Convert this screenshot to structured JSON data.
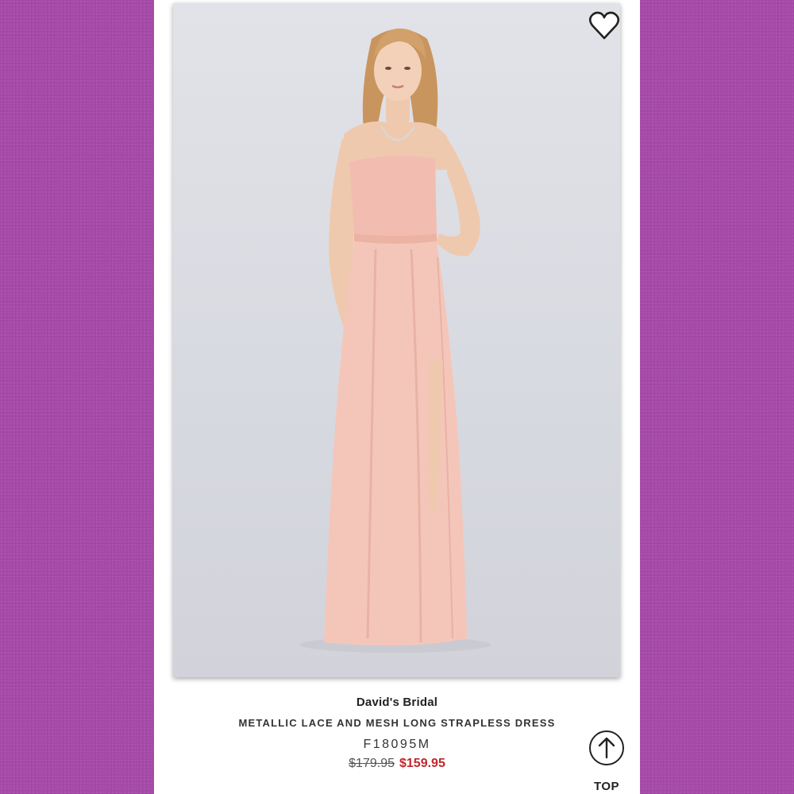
{
  "product": {
    "brand": "David's Bridal",
    "name": "METALLIC LACE AND MESH LONG STRAPLESS DRESS",
    "sku": "F18095M",
    "price_original": "$179.95",
    "price_sale": "$159.95"
  },
  "controls": {
    "top_label": "TOP",
    "favorite_icon": "heart-outline-icon",
    "top_icon": "arrow-up-icon"
  },
  "colors": {
    "background": "#a64aa8",
    "sale_price": "#c0262d",
    "dress": "#f3c2b6"
  }
}
